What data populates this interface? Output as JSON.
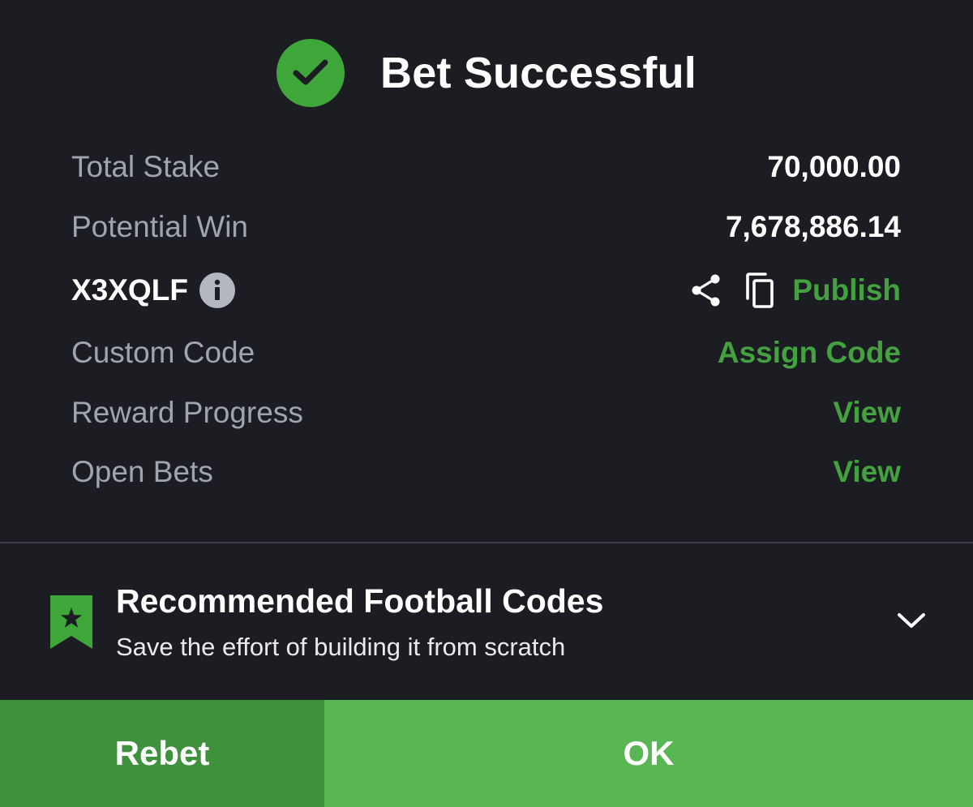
{
  "header": {
    "title": "Bet Successful",
    "icon": "check-circle-icon",
    "accent": "#3fa63a"
  },
  "summary": {
    "total_stake_label": "Total Stake",
    "total_stake_value": "70,000.00",
    "potential_win_label": "Potential Win",
    "potential_win_value": "7,678,886.14"
  },
  "booking": {
    "code": "X3XQLF",
    "info_icon": "info-icon",
    "share_icon": "share-icon",
    "copy_icon": "copy-icon",
    "publish_label": "Publish"
  },
  "links": {
    "custom_code_label": "Custom Code",
    "custom_code_action": "Assign Code",
    "reward_progress_label": "Reward Progress",
    "reward_progress_action": "View",
    "open_bets_label": "Open Bets",
    "open_bets_action": "View"
  },
  "recommended": {
    "title": "Recommended Football Codes",
    "subtitle": "Save the effort of building it from scratch",
    "icon": "bookmark-star-icon",
    "expand_icon": "chevron-down-icon"
  },
  "footer": {
    "rebet_label": "Rebet",
    "ok_label": "OK"
  },
  "colors": {
    "background": "#1c1d22",
    "green_link": "#44a13f",
    "rebet_bg": "#3f913b",
    "ok_bg": "#58b654"
  }
}
